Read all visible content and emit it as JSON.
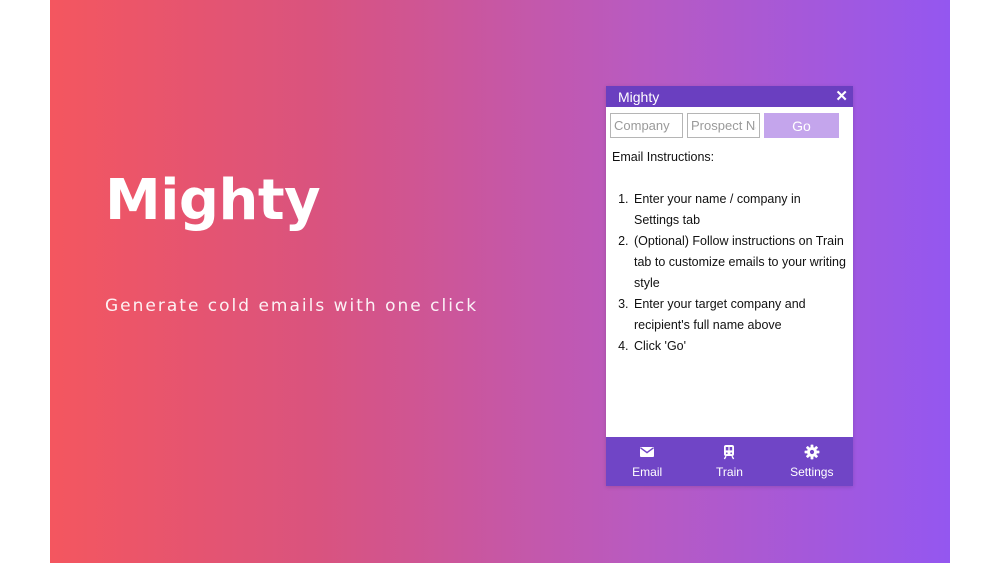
{
  "hero": {
    "title": "Mighty",
    "subtitle": "Generate cold emails with one click"
  },
  "popup": {
    "title": "Mighty",
    "close_icon": "close-icon",
    "company_placeholder": "Company",
    "prospect_placeholder": "Prospect Name",
    "go_label": "Go",
    "instructions_heading": "Email Instructions:",
    "steps": [
      "Enter your name / company in Settings tab",
      "(Optional) Follow instructions on Train tab to customize emails to your writing style",
      "Enter your target company and recipient's full name above",
      "Click 'Go'"
    ],
    "tabs": [
      {
        "label": "Email",
        "icon": "envelope-icon"
      },
      {
        "label": "Train",
        "icon": "train-icon"
      },
      {
        "label": "Settings",
        "icon": "gear-icon"
      }
    ]
  },
  "colors": {
    "gradient_start": "#f4565f",
    "gradient_end": "#9457f0",
    "header_purple": "#6a3fc0",
    "footer_purple": "#7045c6",
    "go_button": "#c4a5ec"
  }
}
